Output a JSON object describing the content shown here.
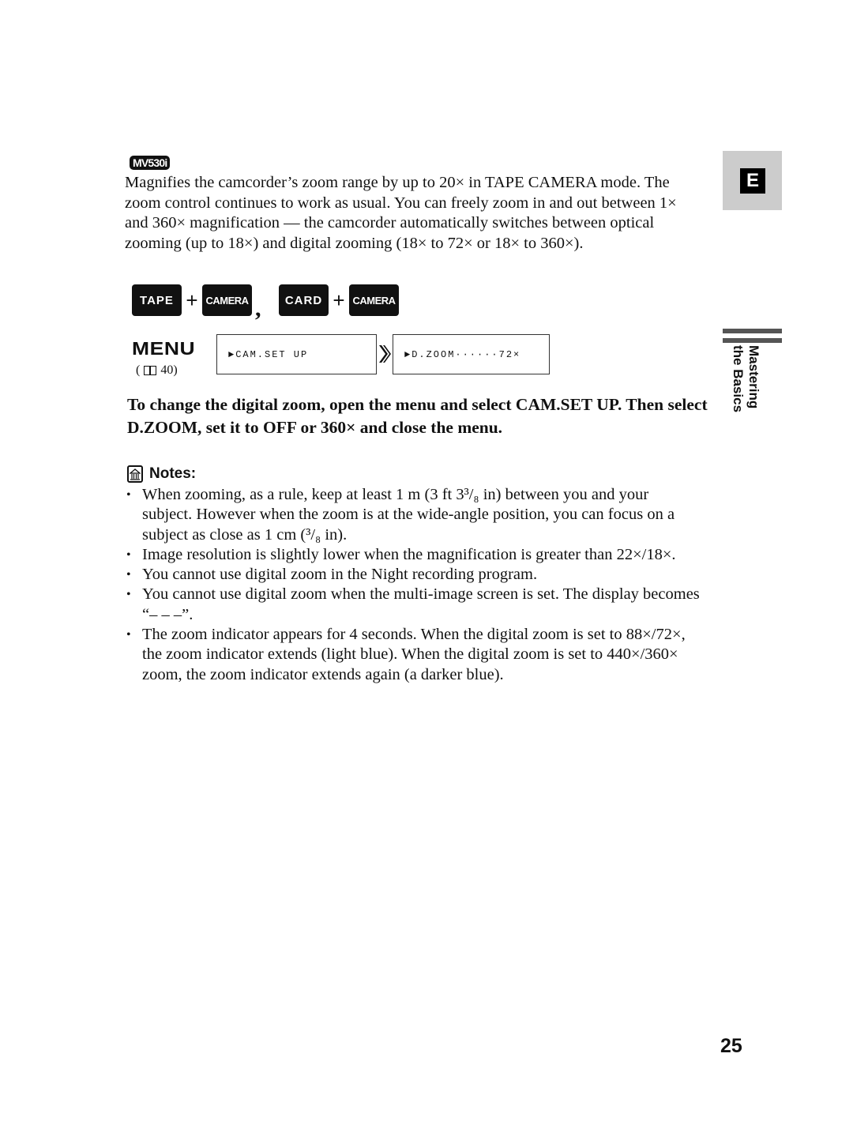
{
  "model_badge": "MV530i",
  "intro_text": "Magnifies the camcorder’s zoom range by up to 20× in TAPE CAMERA mode. The zoom control continues to work as usual. You can freely zoom in and out between 1× and 360× magnification — the camcorder automatically switches between optical zooming (up to 18×) and digital zooming (18× to 72× or 18× to 360×).",
  "modes": {
    "tape": "TAPE",
    "camera_1": "CAMERA",
    "card": "CARD",
    "camera_2": "CAMERA",
    "plus": "+",
    "separator": ","
  },
  "menu": {
    "label": "MENU",
    "ref_open": "(",
    "ref_page": "40)",
    "screen_1": "►CAM.SET UP",
    "screen_2": "►D.ZOOM······72×"
  },
  "instruction": "To change the digital zoom, open the menu and select CAM.SET UP. Then select D.ZOOM, set it to OFF or 360× and close the menu.",
  "notes": {
    "title": "Notes:",
    "items": [
      "When zooming, as a rule, keep at least 1 m (3 ft 3³/₈ in) between you and your subject. However when the zoom is at the wide-angle position, you can focus on a subject as close as 1 cm (³/₈ in).",
      "Image resolution is slightly lower when the magnification is greater than 22×/18×.",
      "You cannot use digital zoom in the Night recording program.",
      "You cannot use digital zoom when the multi-image screen is set. The display becomes “– – –”.",
      "The zoom indicator appears for 4 seconds. When the digital zoom is set to 88×/72×, the zoom indicator extends (light blue). When the digital zoom is set to 440×/360× zoom, the zoom indicator extends again (a darker blue)."
    ]
  },
  "side_tab": {
    "language": "E",
    "section_line_1": "Mastering",
    "section_line_2": "the Basics"
  },
  "page_number": "25"
}
